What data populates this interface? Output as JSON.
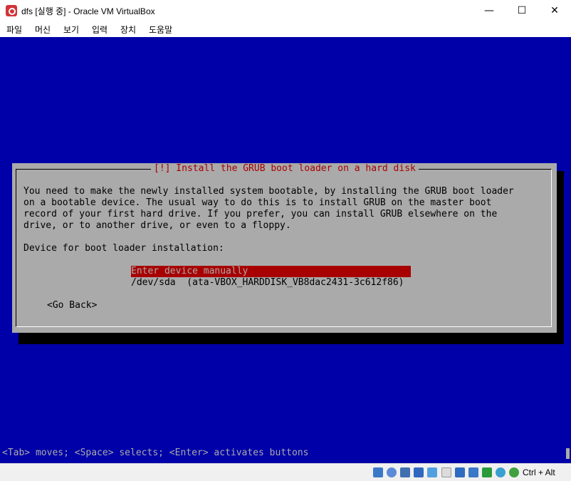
{
  "window": {
    "title": "dfs [실행 중] - Oracle VM VirtualBox",
    "minimize": "—",
    "maximize": "☐",
    "close": "✕"
  },
  "menu": [
    "파일",
    "머신",
    "보기",
    "입력",
    "장치",
    "도움말"
  ],
  "installer": {
    "dialog_title": "[!] Install the GRUB boot loader on a hard disk",
    "description_lines": [
      "You need to make the newly installed system bootable, by installing the GRUB boot loader",
      "on a bootable device. The usual way to do this is to install GRUB on the master boot",
      "record of your first hard drive. If you prefer, you can install GRUB elsewhere on the",
      "drive, or to another drive, or even to a floppy."
    ],
    "prompt": "Device for boot loader installation:",
    "options": [
      "Enter device manually",
      "/dev/sda  (ata-VBOX_HARDDISK_VB8dac2431-3c612f86)"
    ],
    "selected_index": 0,
    "back_button": "<Go Back>",
    "help_line": "<Tab> moves; <Space> selects; <Enter> activates buttons"
  },
  "statusbar": {
    "host_key": "Ctrl + Alt",
    "icons": [
      "harddisk-icon",
      "optical-drive-icon",
      "audio-icon",
      "network-icon",
      "usb-icon",
      "shared-folder-icon",
      "display-icon",
      "video-capture-icon",
      "cpu-icon",
      "mouse-integration-icon",
      "keyboard-icon"
    ]
  },
  "colors": {
    "screen_bg": "#0000a8",
    "dialog_bg": "#aaaaaa",
    "title_red": "#a80000",
    "selection_bg": "#a80000"
  }
}
